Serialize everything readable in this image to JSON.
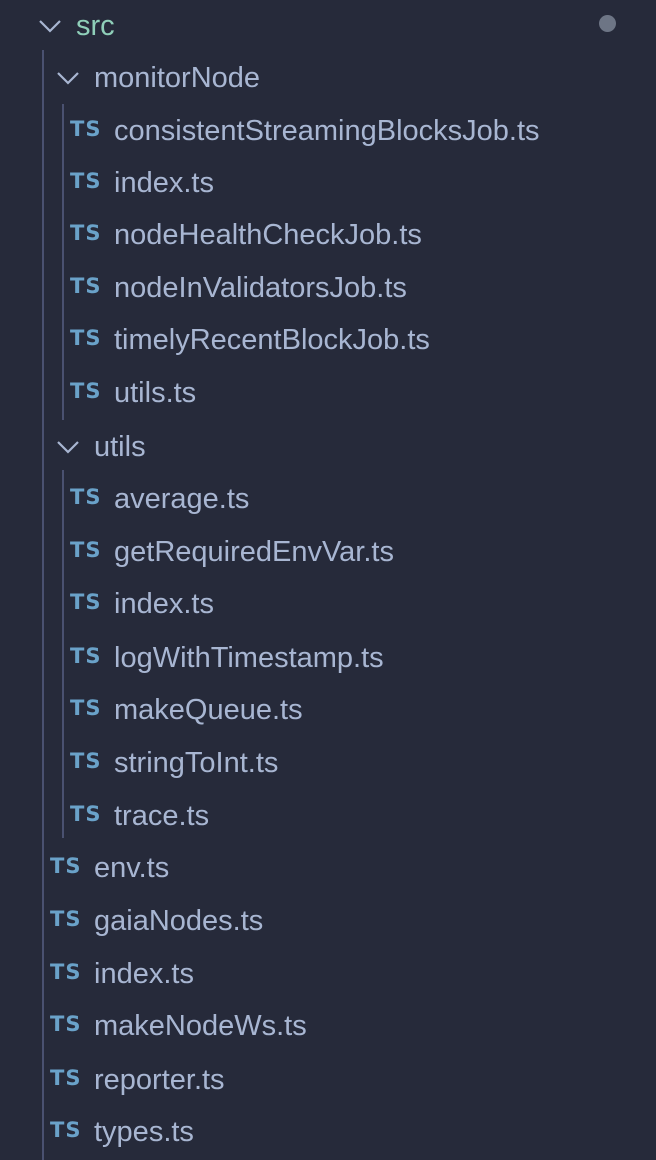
{
  "tree": {
    "root": {
      "label": "src",
      "expanded": true,
      "chevron_icon": "chevron-down-icon",
      "modified_indicator": "dot-icon"
    },
    "monitorNode": {
      "label": "monitorNode",
      "expanded": true,
      "chevron_icon": "chevron-down-icon",
      "files": [
        {
          "badge": "TS",
          "name": "consistentStreamingBlocksJob.ts"
        },
        {
          "badge": "TS",
          "name": "index.ts"
        },
        {
          "badge": "TS",
          "name": "nodeHealthCheckJob.ts"
        },
        {
          "badge": "TS",
          "name": "nodeInValidatorsJob.ts"
        },
        {
          "badge": "TS",
          "name": "timelyRecentBlockJob.ts"
        },
        {
          "badge": "TS",
          "name": "utils.ts"
        }
      ]
    },
    "utils": {
      "label": "utils",
      "expanded": true,
      "chevron_icon": "chevron-down-icon",
      "files": [
        {
          "badge": "TS",
          "name": "average.ts"
        },
        {
          "badge": "TS",
          "name": "getRequiredEnvVar.ts"
        },
        {
          "badge": "TS",
          "name": "index.ts"
        },
        {
          "badge": "TS",
          "name": "logWithTimestamp.ts"
        },
        {
          "badge": "TS",
          "name": "makeQueue.ts"
        },
        {
          "badge": "TS",
          "name": "stringToInt.ts"
        },
        {
          "badge": "TS",
          "name": "trace.ts"
        }
      ]
    },
    "root_files": [
      {
        "badge": "TS",
        "name": "env.ts"
      },
      {
        "badge": "TS",
        "name": "gaiaNodes.ts"
      },
      {
        "badge": "TS",
        "name": "index.ts"
      },
      {
        "badge": "TS",
        "name": "makeNodeWs.ts"
      },
      {
        "badge": "TS",
        "name": "reporter.ts"
      },
      {
        "badge": "TS",
        "name": "types.ts"
      }
    ]
  },
  "colors": {
    "background": "#262a3a",
    "text": "#a8b6d2",
    "folder_src": "#8fcfb9",
    "ts_badge": "#6aa2c9",
    "guide": "#4a5170",
    "dot": "#6d7585"
  }
}
